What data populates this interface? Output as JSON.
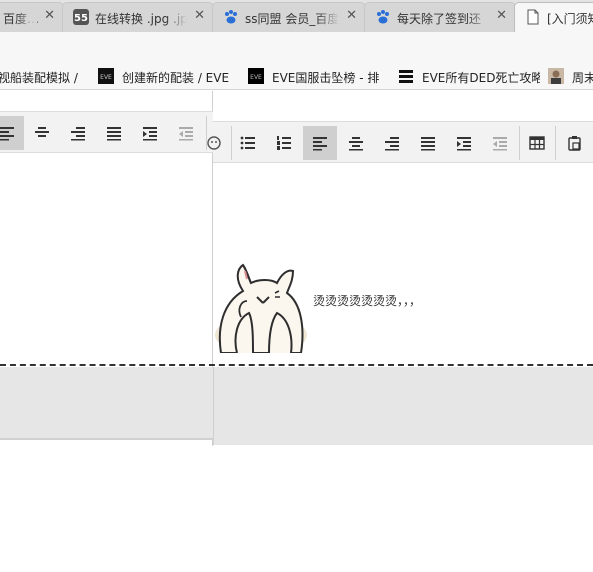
{
  "tabs": [
    {
      "label": "百度…",
      "icon": "paw-icon",
      "close": "✕"
    },
    {
      "label": "在线转换 .jpg .jp",
      "icon": "55-logo-icon",
      "close": "✕"
    },
    {
      "label": "ss同盟 会员_百度",
      "icon": "paw-icon",
      "close": "✕"
    },
    {
      "label": "每天除了签到还",
      "icon": "paw-icon",
      "close": "✕"
    },
    {
      "label": "[入门须知",
      "icon": "document-icon",
      "close": ""
    }
  ],
  "bookmarks": [
    {
      "label": "视船装配模拟 /"
    },
    {
      "label": "创建新的配装 / EVE",
      "icon": "eve-logo-icon"
    },
    {
      "label": "EVE国服击坠榜 - 排",
      "icon": "eve-dark-icon"
    },
    {
      "label": "EVE所有DED死亡攻略",
      "icon": "menu-lines-icon"
    },
    {
      "label": "周末",
      "icon": "portrait-icon"
    }
  ],
  "editor": {
    "message": "烫烫烫烫烫烫烫，，，"
  },
  "colors": {
    "accent_active_button": "#cfcfcf",
    "toolbar_bg": "#f2f2f2",
    "footer_bg": "#e6e6e6"
  }
}
